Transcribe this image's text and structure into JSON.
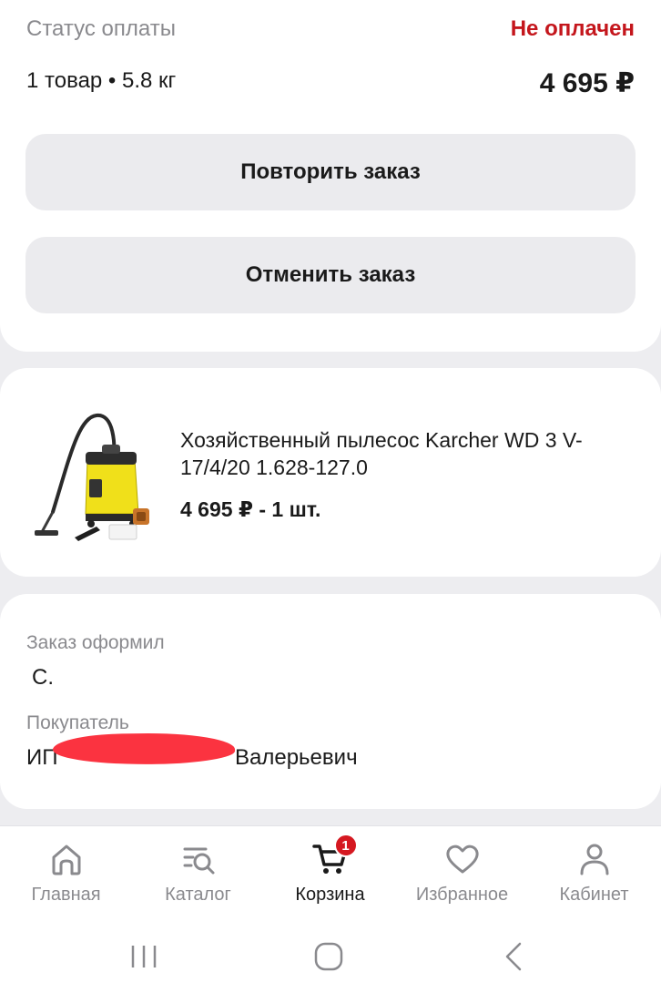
{
  "summary": {
    "payment_status_label": "Статус оплаты",
    "payment_status_value": "Не оплачен",
    "items_summary": "1 товар • 5.8 кг",
    "total": "4 695 ₽",
    "repeat_order_label": "Повторить заказ",
    "cancel_order_label": "Отменить заказ"
  },
  "product": {
    "name": "Хозяйственный пылесос Karcher WD 3 V-17/4/20 1.628-127.0",
    "price_qty": "4 695 ₽ - 1 шт.",
    "image_icon": "vacuum-cleaner-image"
  },
  "people": {
    "ordered_by_label": "Заказ оформил",
    "ordered_by_value": "С.",
    "buyer_label": "Покупатель",
    "buyer_prefix": "ИП",
    "buyer_suffix": "Валерьевич"
  },
  "tabbar": {
    "tabs": [
      {
        "label": "Главная",
        "icon": "home-icon",
        "active": false
      },
      {
        "label": "Каталог",
        "icon": "catalog-search-icon",
        "active": false
      },
      {
        "label": "Корзина",
        "icon": "cart-icon",
        "active": true,
        "badge": "1"
      },
      {
        "label": "Избранное",
        "icon": "heart-icon",
        "active": false
      },
      {
        "label": "Кабинет",
        "icon": "user-icon",
        "active": false
      }
    ]
  },
  "colors": {
    "accent_red": "#c4161c",
    "badge_red": "#d51820",
    "button_bg": "#ebebee",
    "page_bg": "#ededf0"
  }
}
